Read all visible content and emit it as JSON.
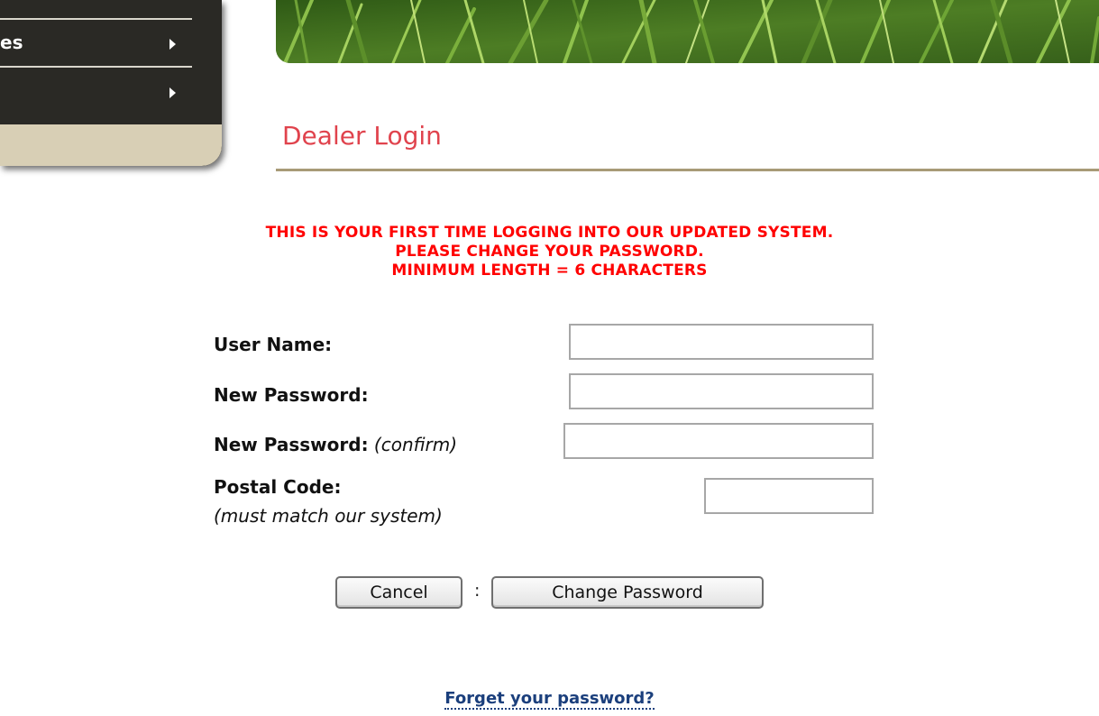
{
  "menu": {
    "items": [
      {
        "label": "es"
      },
      {
        "label": ""
      }
    ]
  },
  "header": {
    "title": "Dealer Login"
  },
  "notice": {
    "lines": [
      "THIS IS YOUR FIRST TIME LOGGING INTO OUR UPDATED SYSTEM.",
      "PLEASE CHANGE YOUR PASSWORD.",
      "MINIMUM LENGTH = 6 CHARACTERS"
    ]
  },
  "form": {
    "username_label": "User Name:",
    "username_value": "",
    "new_password_label": "New Password:",
    "new_password_value": "",
    "confirm_password_label": "New Password:",
    "confirm_password_hint": "(confirm)",
    "confirm_password_value": "",
    "postal_code_label": "Postal Code:",
    "postal_code_hint": "(must match our system)",
    "postal_code_value": ""
  },
  "buttons": {
    "cancel_label": "Cancel",
    "separator": ":",
    "change_password_label": "Change Password"
  },
  "links": {
    "forgot_password": "Forget your password?"
  },
  "colors": {
    "title": "#e0434d",
    "notice": "#ff0000",
    "link": "#1b3f7c",
    "menu_bg": "#2a2925",
    "menu_accent": "#d8cfb5",
    "rule": "#a89b77"
  }
}
